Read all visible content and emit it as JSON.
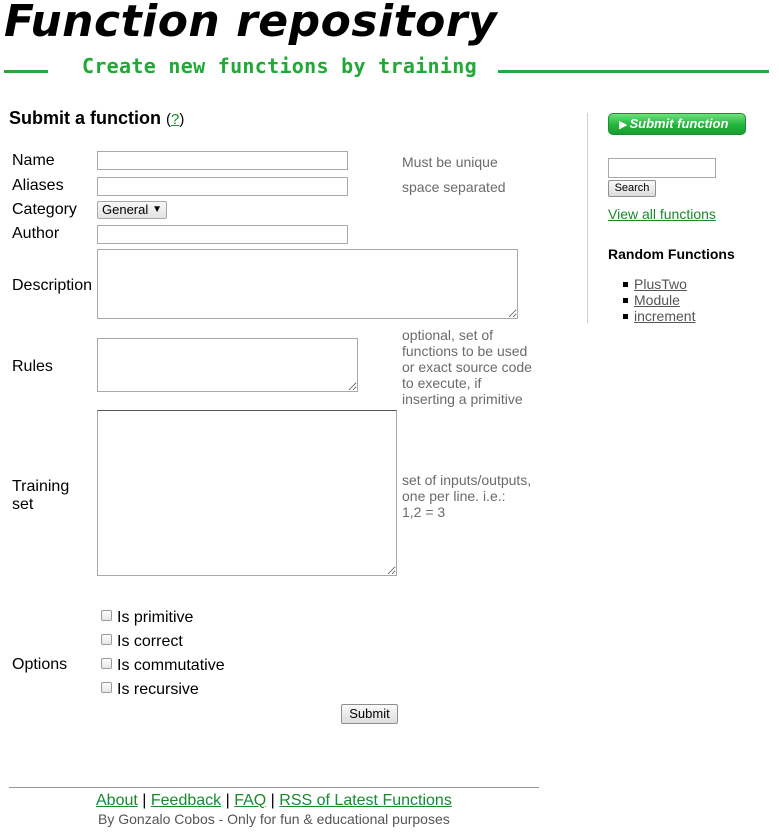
{
  "header": {
    "title": "Function repository",
    "tagline": "Create new functions by training"
  },
  "form": {
    "heading": "Submit a function",
    "help_open": "(",
    "help_link": "?",
    "help_close": ")",
    "fields": {
      "name": {
        "label": "Name",
        "value": "",
        "hint": "Must be unique"
      },
      "aliases": {
        "label": "Aliases",
        "value": "",
        "hint": "space separated"
      },
      "category": {
        "label": "Category",
        "value": "General"
      },
      "author": {
        "label": "Author",
        "value": ""
      },
      "description": {
        "label": "Description",
        "value": ""
      },
      "rules": {
        "label": "Rules",
        "value": "",
        "hint_lines": [
          "optional, set of",
          "functions to be used",
          "or exact source code",
          "to execute, if",
          "inserting a primitive"
        ]
      },
      "training": {
        "label_lines": [
          "Training",
          "set"
        ],
        "value": "",
        "hint_lines": [
          "set of inputs/outputs,",
          "one per line. i.e.:",
          "1,2 = 3"
        ]
      }
    },
    "options": {
      "label": "Options",
      "checkboxes": [
        {
          "label": "Is primitive",
          "checked": false
        },
        {
          "label": "Is correct",
          "checked": false
        },
        {
          "label": "Is commutative",
          "checked": false
        },
        {
          "label": "Is recursive",
          "checked": false
        }
      ]
    },
    "submit_label": "Submit"
  },
  "sidebar": {
    "submit_function_label": "Submit function",
    "search_value": "",
    "search_button": "Search",
    "view_all": "View all functions",
    "random_heading": "Random Functions",
    "random_functions": [
      "PlusTwo",
      "Module",
      "increment"
    ]
  },
  "footer": {
    "links": [
      "About",
      "Feedback",
      "FAQ",
      "RSS of Latest Functions"
    ],
    "separator": "|",
    "credit": "By Gonzalo Cobos - Only for fun & educational purposes"
  },
  "colors": {
    "accent_green": "#1faa35",
    "link_green": "#1a8a2a",
    "hint_gray": "#6b6b6b"
  },
  "icons": {
    "submit_function": "play-icon",
    "category_select": "triangle-down-icon"
  }
}
